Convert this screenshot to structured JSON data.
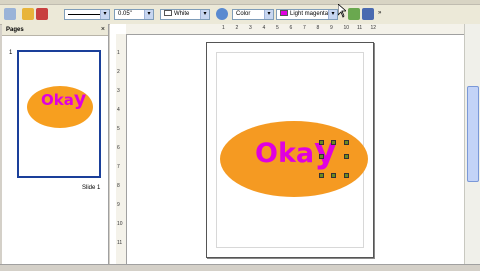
{
  "toolbar": {
    "line_width": "0.05\"",
    "line_color": "White",
    "fill_type": "Color",
    "fill_color": "Light magenta",
    "fill_color_hex": "#e000e0"
  },
  "pages_pane": {
    "title": "Pages",
    "close_glyph": "×",
    "thumbnail_number": "1",
    "slide_label": "Slide 1"
  },
  "slide": {
    "text_small": "Oka",
    "text_big": "y",
    "text_color": "#e000e0",
    "ellipse_color": "#f59a22"
  },
  "hruler_nums": [
    "1",
    "2",
    "3",
    "4",
    "5",
    "6",
    "7",
    "8",
    "9",
    "10",
    "11",
    "12"
  ],
  "vruler_nums": [
    "1",
    "2",
    "3",
    "4",
    "5",
    "6",
    "7",
    "8",
    "9",
    "10",
    "11"
  ]
}
